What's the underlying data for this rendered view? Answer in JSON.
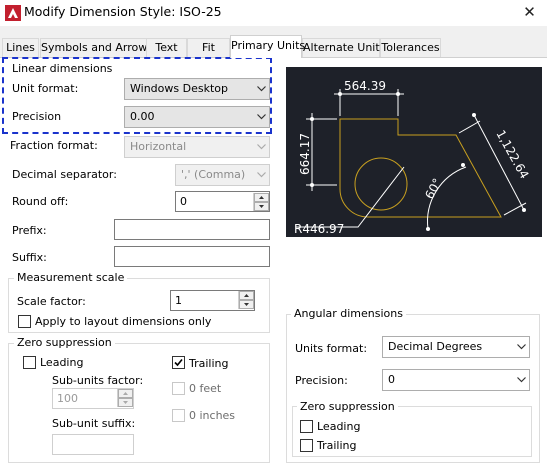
{
  "window": {
    "title": "Modify Dimension Style: ISO-25",
    "close_glyph": "✕"
  },
  "tabs": [
    "Lines",
    "Symbols and Arrows",
    "Text",
    "Fit",
    "Primary Units",
    "Alternate Units",
    "Tolerances"
  ],
  "linear": {
    "group_title": "Linear dimensions",
    "unit_format_label": "Unit format:",
    "unit_format_value": "Windows Desktop",
    "precision_label": "Precision",
    "precision_value": "0.00",
    "fraction_label": "Fraction format:",
    "fraction_value": "Horizontal",
    "decimal_label": "Decimal separator:",
    "decimal_value": "','  (Comma)",
    "roundoff_label": "Round off:",
    "roundoff_value": "0",
    "prefix_label": "Prefix:",
    "prefix_value": "",
    "suffix_label": "Suffix:",
    "suffix_value": ""
  },
  "measurement": {
    "group_title": "Measurement scale",
    "scale_label": "Scale factor:",
    "scale_value": "1",
    "apply_layout_label": "Apply to layout dimensions only",
    "apply_layout_checked": false
  },
  "zero_suppression": {
    "group_title": "Zero suppression",
    "leading_label": "Leading",
    "leading_checked": false,
    "trailing_label": "Trailing",
    "trailing_checked": true,
    "subunits_factor_label": "Sub-units factor:",
    "subunits_factor_value": "100",
    "zero_feet_label": "0 feet",
    "zero_inches_label": "0 inches",
    "subunit_suffix_label": "Sub-unit suffix:",
    "subunit_suffix_value": ""
  },
  "preview": {
    "dim_top": "564.39",
    "dim_left": "664.17",
    "dim_diag": "1,122.64",
    "dim_angle": "60°",
    "dim_radius": "R446.97",
    "colors": {
      "background": "#1e2129",
      "geometry": "#c8a020",
      "dims": "#ffffff"
    }
  },
  "angular": {
    "group_title": "Angular dimensions",
    "units_label": "Units format:",
    "units_value": "Decimal Degrees",
    "precision_label": "Precision:",
    "precision_value": "0",
    "zero_title": "Zero suppression",
    "leading_label": "Leading",
    "trailing_label": "Trailing",
    "leading_checked": false,
    "trailing_checked": false
  }
}
